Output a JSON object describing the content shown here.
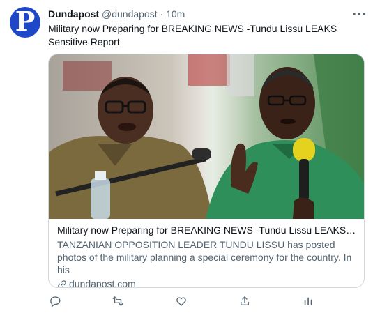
{
  "author": {
    "name": "Dundapost",
    "handle": "@dundapost",
    "separator": "·",
    "time": "10m",
    "avatar_letter": "P",
    "avatar_color": "#1f48c8"
  },
  "tweet": {
    "text": "Military now Preparing for BREAKING NEWS -Tundu Lissu LEAKS Sensitive Report"
  },
  "card": {
    "title": "Military now Preparing for BREAKING NEWS -Tundu Lissu LEAKS Sensiti...",
    "description": "TANZANIAN OPPOSITION LEADER TUNDU LISSU has posted photos of the military planning a special ceremony for the country. In his",
    "domain": "dundapost.com"
  },
  "actions": [
    "reply-icon",
    "retweet-icon",
    "like-icon",
    "share-icon",
    "analytics-icon"
  ],
  "colors": {
    "text": "#0f1419",
    "secondary": "#536471",
    "border": "#cfd9de"
  }
}
